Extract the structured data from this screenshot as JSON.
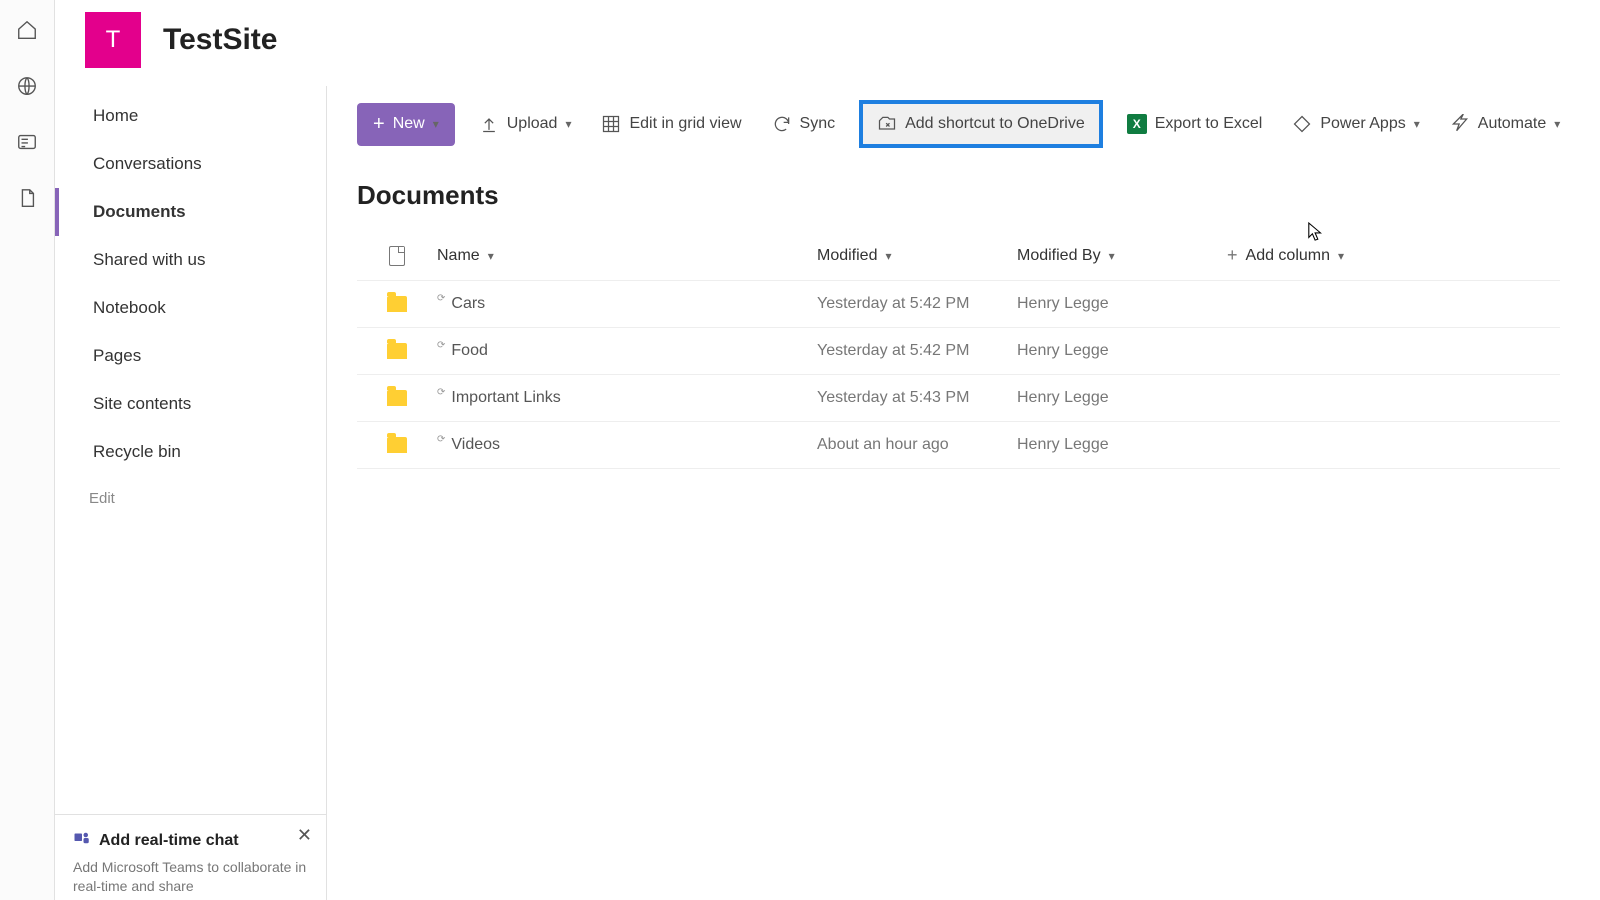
{
  "site": {
    "tile_letter": "T",
    "title": "TestSite"
  },
  "sidebar": {
    "items": [
      {
        "label": "Home"
      },
      {
        "label": "Conversations"
      },
      {
        "label": "Documents"
      },
      {
        "label": "Shared with us"
      },
      {
        "label": "Notebook"
      },
      {
        "label": "Pages"
      },
      {
        "label": "Site contents"
      },
      {
        "label": "Recycle bin"
      }
    ],
    "active_index": 2,
    "edit_label": "Edit"
  },
  "chat_card": {
    "title": "Add real-time chat",
    "body": "Add Microsoft Teams to collaborate in real-time and share"
  },
  "toolbar": {
    "new_label": "New",
    "upload_label": "Upload",
    "grid_label": "Edit in grid view",
    "sync_label": "Sync",
    "shortcut_label": "Add shortcut to OneDrive",
    "excel_label": "Export to Excel",
    "powerapps_label": "Power Apps",
    "automate_label": "Automate"
  },
  "section_title": "Documents",
  "columns": {
    "name": "Name",
    "modified": "Modified",
    "modified_by": "Modified By",
    "add": "Add column"
  },
  "rows": [
    {
      "name": "Cars",
      "modified": "Yesterday at 5:42 PM",
      "by": "Henry Legge"
    },
    {
      "name": "Food",
      "modified": "Yesterday at 5:42 PM",
      "by": "Henry Legge"
    },
    {
      "name": "Important Links",
      "modified": "Yesterday at 5:43 PM",
      "by": "Henry Legge"
    },
    {
      "name": "Videos",
      "modified": "About an hour ago",
      "by": "Henry Legge"
    }
  ]
}
